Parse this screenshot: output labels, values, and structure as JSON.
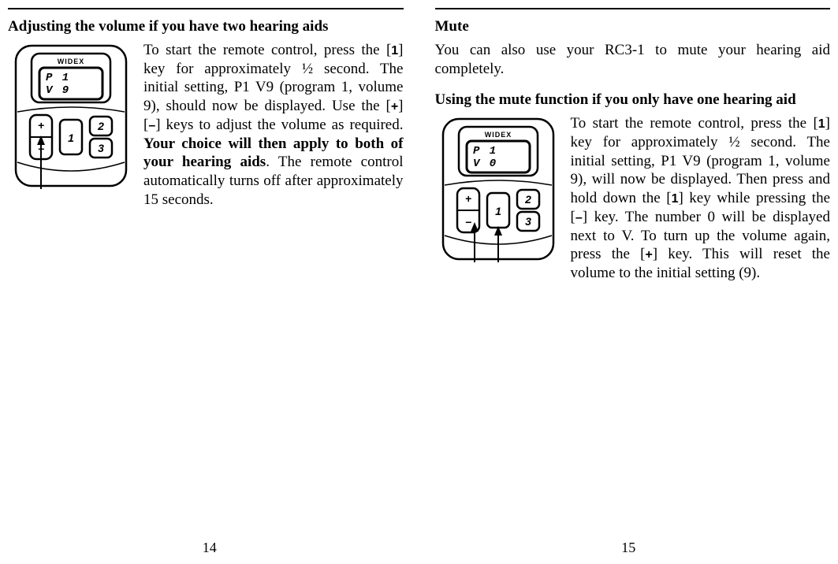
{
  "left": {
    "heading": "Adjusting the volume if you have two hearing aids",
    "remote": {
      "brand": "WIDEX",
      "line1": "P   1",
      "line2": "V   9"
    },
    "para_parts": {
      "t1": "To start the remote control, press the [",
      "k1": "1",
      "t2": "] key for approximately ½ second. The initial setting, P1 V9 (program 1, volume 9), should now be displayed. Use the [",
      "k2": "+",
      "t3": "] [",
      "k3": "–",
      "t4": "] keys to adjust the volume as re­quired. ",
      "bold": "Your choice will then ap­ply to both of your hearing aids",
      "t5": ". The remote control automatically turns off after approximately 15 seconds."
    },
    "pagenum": "14"
  },
  "right": {
    "heading1": "Mute",
    "intro": "You can also use your RC3-1 to mute your hearing aid completely.",
    "heading2": "Using the mute function if you only have one hearing aid",
    "remote": {
      "brand": "WIDEX",
      "line1": "P   1",
      "line2": "V   0"
    },
    "para_parts": {
      "t1": "To start the remote control, press the [",
      "k1": "1",
      "t2": "] key for approximately ½ second. The initial setting, P1 V9 (program 1, volume 9), will now be displayed. Then press and hold down the [",
      "k2": "1",
      "t3": "] key while pressing the [",
      "k3": "–",
      "t4": "] key. The number 0 will be displayed next to V. To turn up the volume again, press the [",
      "k4": "+",
      "t5": "] key.  This will reset the volume to the initial setting (9)."
    },
    "pagenum": "15"
  }
}
